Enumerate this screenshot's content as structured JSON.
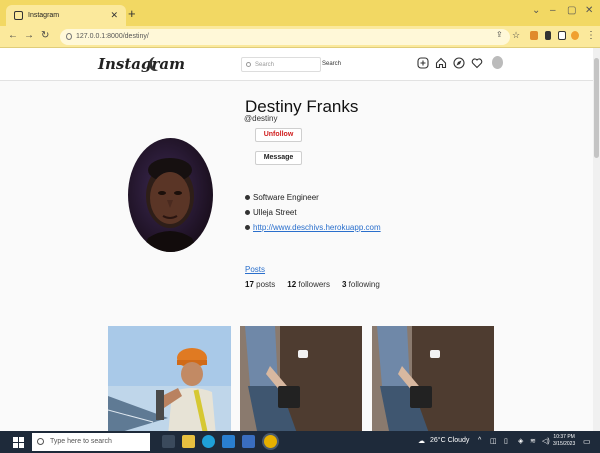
{
  "browser": {
    "tab_title": "Instagram",
    "url": "127.0.0.1:8000/destiny/"
  },
  "header": {
    "logo": "Instagram",
    "search_placeholder": "Search",
    "search_button": "Search"
  },
  "profile": {
    "name": "Destiny Franks",
    "handle": "@destiny",
    "unfollow_label": "Unfollow",
    "message_label": "Message",
    "bio": [
      "Software Engineer",
      "Ulleja Street"
    ],
    "website": "http://www.deschivs.herokuapp.com",
    "posts_tab": "Posts",
    "posts_count": "17",
    "posts_label": "posts",
    "followers_count": "12",
    "followers_label": "followers",
    "following_count": "3",
    "following_label": "following"
  },
  "taskbar": {
    "search_placeholder": "Type here to search",
    "weather": "26°C Cloudy",
    "time": "10:37 PM",
    "date": "3/15/2023"
  },
  "colors": {
    "browser_tabbar": "#f2d863",
    "unfollow_red": "#d01e1e",
    "link_blue": "#2a6fcc",
    "taskbar": "#1e2a3a"
  }
}
